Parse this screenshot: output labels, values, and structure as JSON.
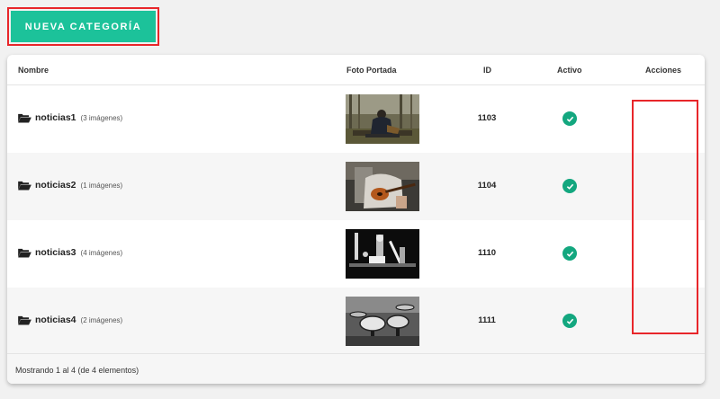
{
  "toolbar": {
    "new_category_label": "NUEVA CATEGORÍA"
  },
  "table": {
    "columns": {
      "name": "Nombre",
      "cover": "Foto Portada",
      "id": "ID",
      "active": "Activo",
      "actions": "Acciones"
    },
    "rows": [
      {
        "name": "noticias1",
        "count": "(3 imágenes)",
        "id": "1103",
        "active": true,
        "photo": "man-with-guitar-in-forest"
      },
      {
        "name": "noticias2",
        "count": "(1 imágenes)",
        "id": "1104",
        "active": true,
        "photo": "acoustic-guitar-closeup"
      },
      {
        "name": "noticias3",
        "count": "(4 imágenes)",
        "id": "1110",
        "active": true,
        "photo": "band-on-stage-bw"
      },
      {
        "name": "noticias4",
        "count": "(2 imágenes)",
        "id": "1111",
        "active": true,
        "photo": "drum-kit-bw"
      }
    ],
    "footer": "Mostrando 1 al 4 (de 4 elementos)"
  },
  "icons": {
    "folder": "folder-open-icon",
    "active": "check-circle-icon"
  },
  "colors": {
    "accent": "#1cc29a",
    "highlight": "#e8262a",
    "active": "#13a77f"
  }
}
